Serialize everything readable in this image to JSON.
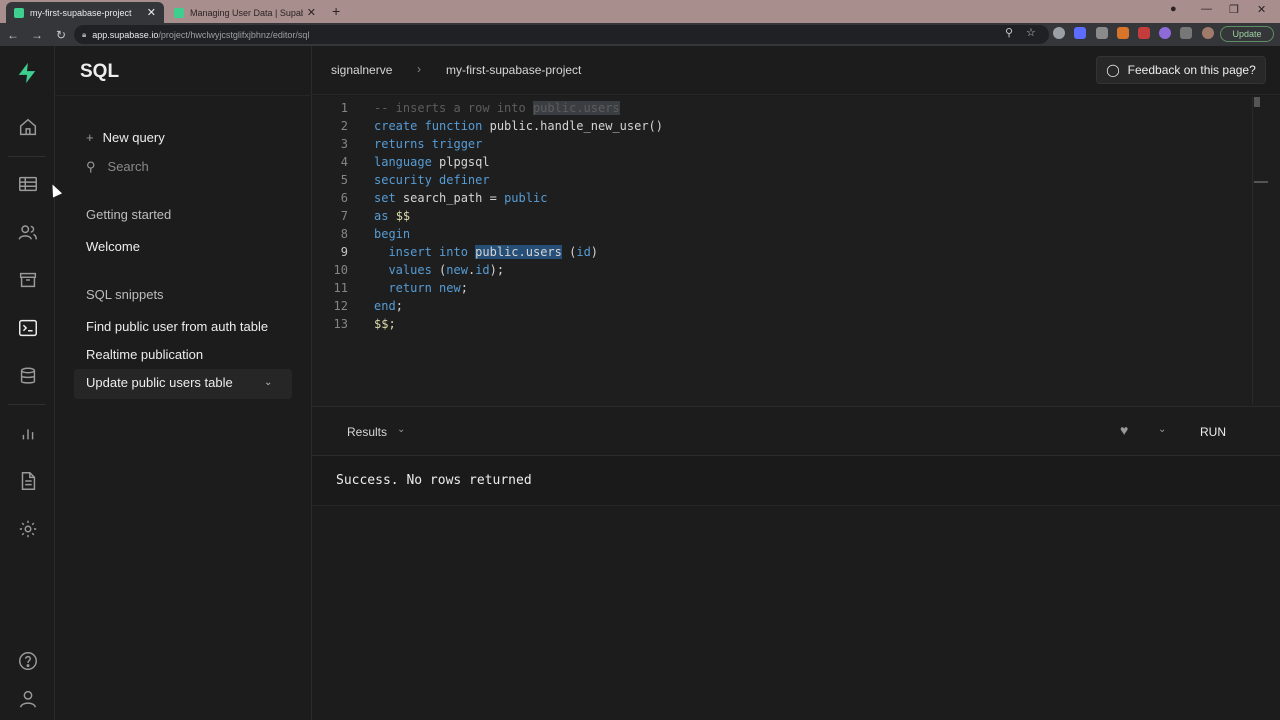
{
  "browser": {
    "tabs": [
      {
        "title": "my-first-supabase-project",
        "active": true
      },
      {
        "title": "Managing User Data | Supabase",
        "active": false
      }
    ],
    "url_host": "app.supabase.io",
    "url_path": "/project/hwclwyjcstglifxjbhnz/editor/sql",
    "update_label": "Update",
    "new_tab": "+",
    "close": "✕",
    "minimize": "—",
    "restore": "❐"
  },
  "sidebar": {
    "title": "SQL",
    "new_query": "New query",
    "search_placeholder": "Search",
    "sections": {
      "getting_started": "Getting started",
      "welcome": "Welcome",
      "snippets": "SQL snippets"
    },
    "snippets": [
      "Find public user from auth table",
      "Realtime publication",
      "Update public users table"
    ]
  },
  "topbar": {
    "org": "signalnerve",
    "sep": "›",
    "project": "my-first-supabase-project",
    "feedback": "Feedback on this page?"
  },
  "editor": {
    "line_numbers": [
      "1",
      "2",
      "3",
      "4",
      "5",
      "6",
      "7",
      "8",
      "9",
      "10",
      "11",
      "12",
      "13"
    ],
    "current_line": 9
  },
  "results": {
    "tab_label": "Results",
    "run_label": "RUN",
    "message": "Success. No rows returned"
  },
  "colors": {
    "accent": "#3ecf8e",
    "keyword": "#569cd6",
    "selection": "#264f78"
  }
}
